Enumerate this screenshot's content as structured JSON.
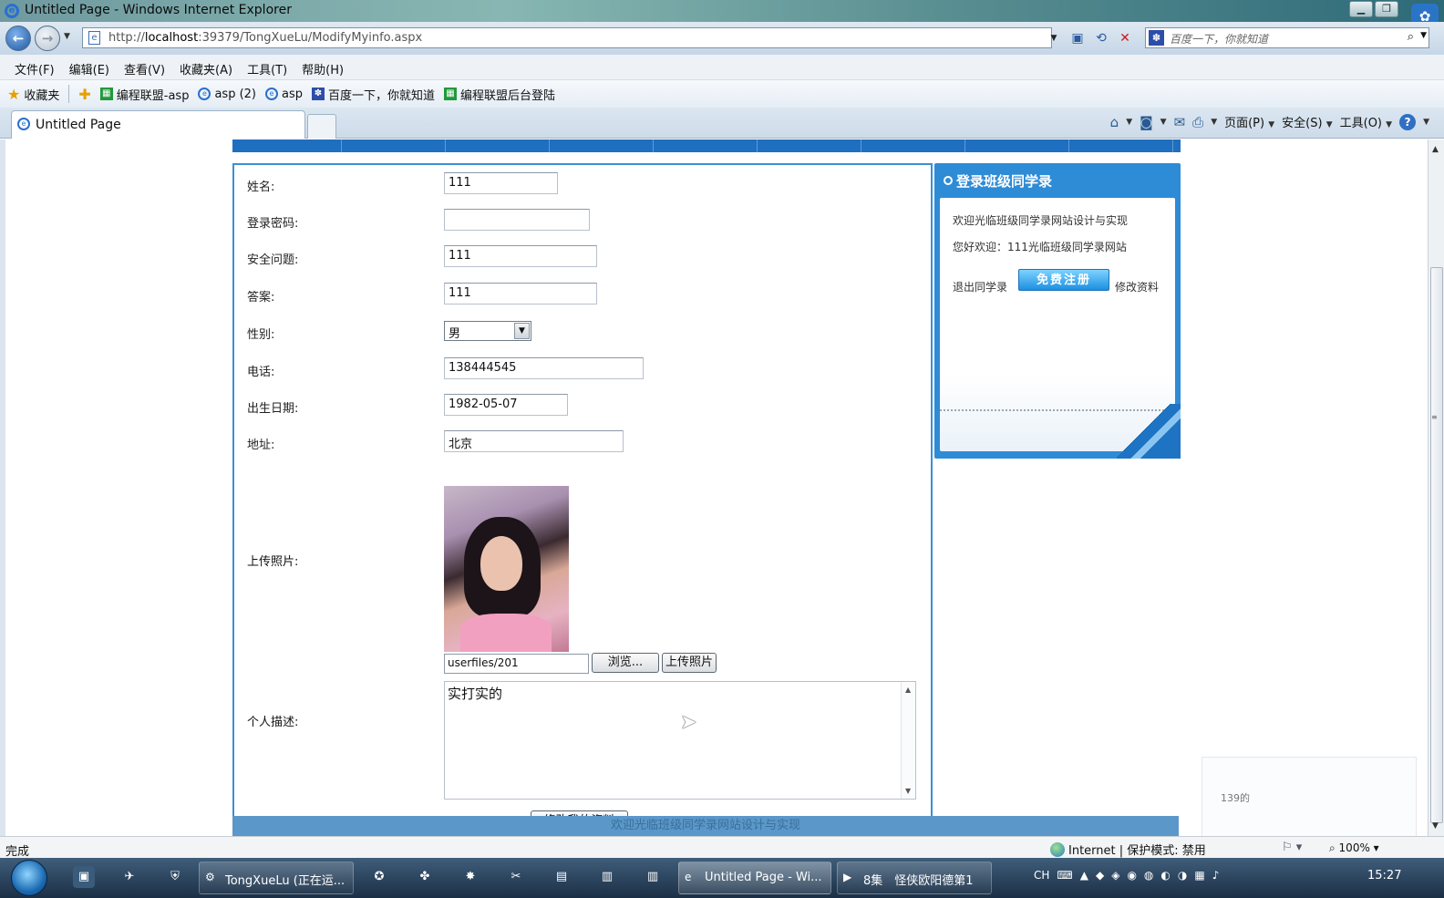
{
  "window": {
    "title": "Untitled Page - Windows Internet Explorer"
  },
  "address_bar": {
    "url_prefix": "http://",
    "url_host": "localhost",
    "url_rest": ":39379/TongXueLu/ModifyMyinfo.aspx",
    "search_placeholder": "百度一下，你就知道"
  },
  "menu": [
    "文件(F)",
    "编辑(E)",
    "查看(V)",
    "收藏夹(A)",
    "工具(T)",
    "帮助(H)"
  ],
  "favorites": {
    "label": "收藏夹",
    "items": [
      "编程联盟-asp",
      "asp (2)",
      "asp",
      "百度一下，你就知道",
      "编程联盟后台登陆"
    ]
  },
  "tab": {
    "label": "Untitled Page"
  },
  "command_bar": {
    "page": "页面(P)",
    "safety": "安全(S)",
    "tools": "工具(O)"
  },
  "form": {
    "name_label": "姓名:",
    "name_value": "111",
    "password_label": "登录密码:",
    "password_value": "",
    "question_label": "安全问题:",
    "question_value": "111",
    "answer_label": "答案:",
    "answer_value": "111",
    "gender_label": "性别:",
    "gender_value": "男",
    "phone_label": "电话:",
    "phone_value": "138444545",
    "birthday_label": "出生日期:",
    "birthday_value": "1982-05-07",
    "address_label": "地址:",
    "address_value": "北京",
    "photo_label": "上传照片:",
    "photo_path": "userfiles/201",
    "browse_label": "浏览...",
    "upload_label": "上传照片",
    "desc_label": "个人描述:",
    "desc_value": "实打实的",
    "submit_label": "修改我的资料"
  },
  "login_panel": {
    "title": "登录班级同学录",
    "welcome": "欢迎光临班级同学录网站设计与实现",
    "greeting": "您好欢迎：111光临班级同学录网站",
    "logout": "退出同学录",
    "signup": "免费注册",
    "edit": "修改资料"
  },
  "footer": {
    "text": "欢迎光临班级同学录网站设计与实现"
  },
  "popup": {
    "text": "139的"
  },
  "status": {
    "done": "完成",
    "zone": "Internet | 保护模式: 禁用",
    "zoom": "100%"
  },
  "taskbar": {
    "buttons": [
      "TongXueLu (正在运...",
      "Untitled Page - Wi...",
      "8集　怪侠欧阳德第1"
    ],
    "lang": "CH",
    "clock": "15:27"
  }
}
